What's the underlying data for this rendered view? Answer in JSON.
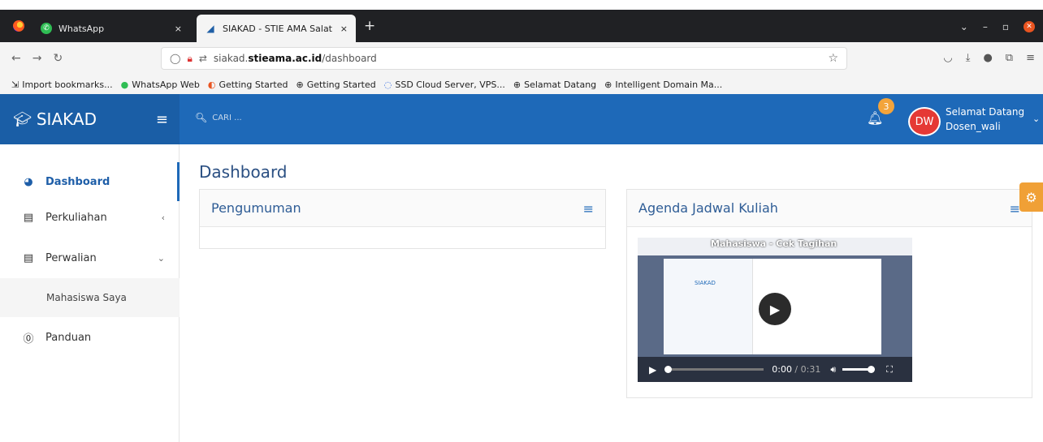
{
  "browser": {
    "tabs": [
      {
        "label": "WhatsApp",
        "close": "×"
      },
      {
        "label": "SIAKAD - STIE AMA Salat",
        "close": "×"
      }
    ],
    "new_tab": "+",
    "url_prefix": "siakad.",
    "url_domain": "stieama.ac.id",
    "url_path": "/dashboard",
    "bookmarks": [
      "Import bookmarks...",
      "WhatsApp Web",
      "Getting Started",
      "Getting Started",
      "SSD Cloud Server, VPS...",
      "Selamat Datang",
      "Intelligent Domain Ma..."
    ]
  },
  "header": {
    "brand": "SIAKAD",
    "search_placeholder": "CARI ...",
    "notification_count": "3",
    "avatar_initials": "DW",
    "greeting": "Selamat Datang",
    "username": "Dosen_wali"
  },
  "sidebar": {
    "items": [
      {
        "label": "Dashboard"
      },
      {
        "label": "Perkuliahan",
        "arrow": "‹"
      },
      {
        "label": "Perwalian",
        "arrow": "⌄"
      },
      {
        "label": "Mahasiswa Saya"
      },
      {
        "label": "Panduan"
      }
    ]
  },
  "main": {
    "page_title": "Dashboard",
    "cards": [
      {
        "title": "Pengumuman"
      },
      {
        "title": "Agenda Jadwal Kuliah"
      }
    ],
    "video": {
      "title": "Mahasiswa - Cek Tagihan",
      "inner_brand": "SIAKAD",
      "time_current": "0:00",
      "time_sep": " / ",
      "time_total": "0:31"
    }
  }
}
